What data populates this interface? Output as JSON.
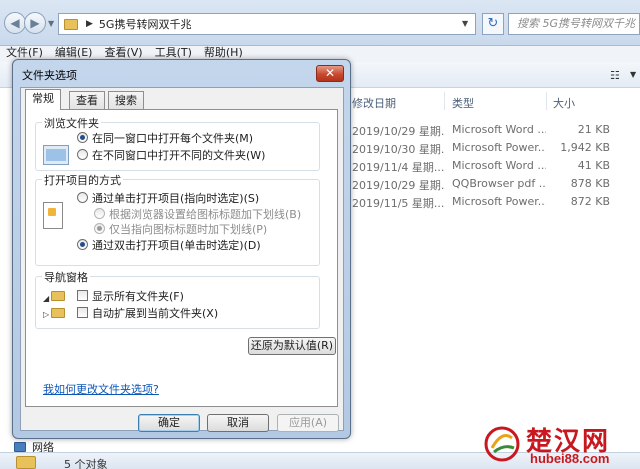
{
  "explorer": {
    "address_path": "5G携号转网双千兆",
    "search_placeholder": "搜索 5G携号转网双千兆",
    "menu": [
      "文件(F)",
      "编辑(E)",
      "查看(V)",
      "工具(T)",
      "帮助(H)"
    ],
    "columns": {
      "modified": "修改日期",
      "type": "类型",
      "size": "大小"
    },
    "files": [
      {
        "modified": "2019/10/29 星期...",
        "type": "Microsoft Word ...",
        "size": "21 KB"
      },
      {
        "modified": "2019/10/30 星期...",
        "type": "Microsoft Power...",
        "size": "1,942 KB"
      },
      {
        "modified": "2019/11/4 星期...",
        "type": "Microsoft Word ...",
        "size": "41 KB"
      },
      {
        "modified": "2019/10/29 星期...",
        "type": "QQBrowser pdf ...",
        "size": "878 KB"
      },
      {
        "modified": "2019/11/5 星期...",
        "type": "Microsoft Power...",
        "size": "872 KB"
      }
    ],
    "nav_network": "网络",
    "status": "5 个对象"
  },
  "dialog": {
    "title": "文件夹选项",
    "close_glyph": "✕",
    "tabs": [
      "常规",
      "查看",
      "搜索"
    ],
    "browse": {
      "title": "浏览文件夹",
      "option_same": "在同一窗口中打开每个文件夹(M)",
      "option_new": "在不同窗口中打开不同的文件夹(W)",
      "selected": "same"
    },
    "click": {
      "title": "打开项目的方式",
      "option_single": "通过单击打开项目(指向时选定)(S)",
      "underline_browser": "根据浏览器设置给图标标题加下划线(B)",
      "underline_point": "仅当指向图标标题时加下划线(P)",
      "option_double": "通过双击打开项目(单击时选定)(D)",
      "selected": "double"
    },
    "nav": {
      "title": "导航窗格",
      "show_all": "显示所有文件夹(F)",
      "auto_expand": "自动扩展到当前文件夹(X)"
    },
    "restore_defaults": "还原为默认值(R)",
    "help_link": "我如何更改文件夹选项?",
    "buttons": {
      "ok": "确定",
      "cancel": "取消",
      "apply": "应用(A)"
    }
  },
  "watermark": {
    "title": "楚汉网",
    "url": "hubei88.com"
  },
  "colors": {
    "accent_link": "#0c56b6",
    "close_red": "#c74a31",
    "watermark_red": "#c9171f"
  }
}
